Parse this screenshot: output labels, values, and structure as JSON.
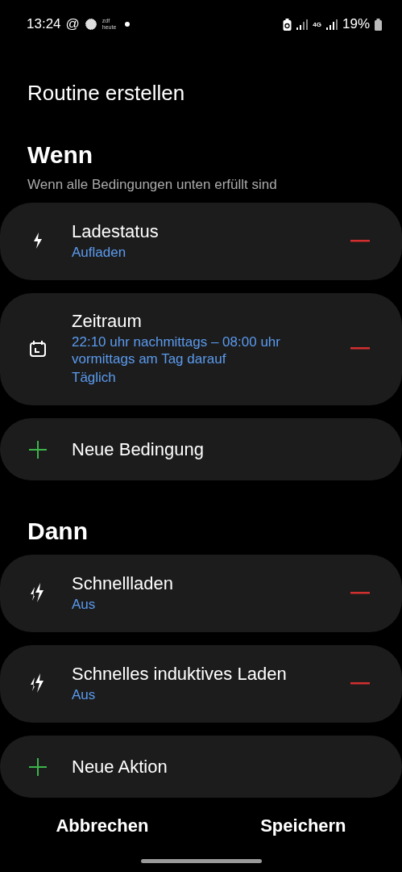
{
  "status_bar": {
    "time": "13:24",
    "at_sign": "@",
    "app_badge": "zdf heute",
    "network": "4G",
    "battery": "19%"
  },
  "title": "Routine erstellen",
  "sections": [
    {
      "heading": "Wenn",
      "subtitle": "Wenn alle Bedingungen unten erfüllt sind",
      "items": [
        {
          "kind": "bolt",
          "title": "Ladestatus",
          "details": [
            "Aufladen"
          ]
        },
        {
          "kind": "calendar",
          "title": "Zeitraum",
          "details": [
            "22:10 uhr nachmittags – 08:00 uhr vormittags am Tag darauf",
            "Täglich"
          ]
        }
      ],
      "add_label": "Neue Bedingung"
    },
    {
      "heading": "Dann",
      "items": [
        {
          "kind": "double-bolt",
          "title": "Schnellladen",
          "details": [
            "Aus"
          ]
        },
        {
          "kind": "double-bolt",
          "title": "Schnelles induktives Laden",
          "details": [
            "Aus"
          ]
        }
      ],
      "add_label": "Neue Aktion"
    }
  ],
  "footer": {
    "cancel": "Abbrechen",
    "save": "Speichern"
  }
}
